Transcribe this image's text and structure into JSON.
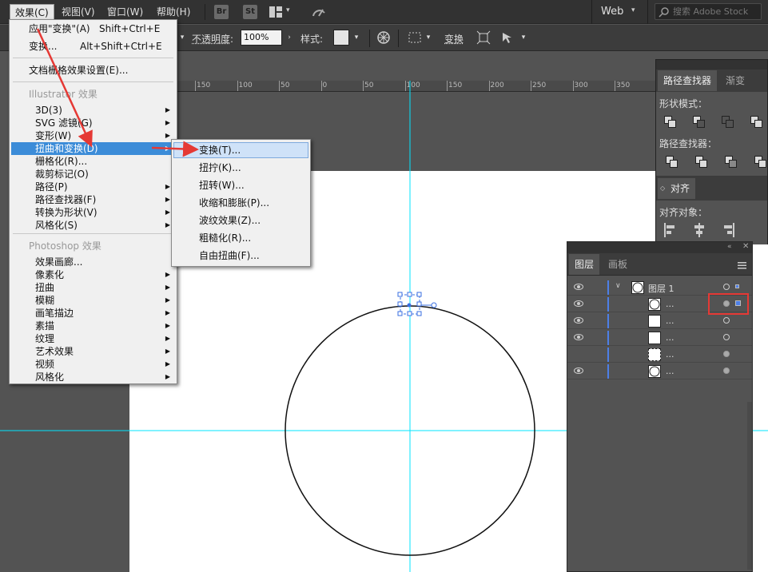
{
  "menubar": {
    "items": [
      "效果(C)",
      "视图(V)",
      "窗口(W)",
      "帮助(H)"
    ],
    "bridge_label": "Br",
    "stock_label": "St",
    "workspace": "Web",
    "search_placeholder": "搜索 Adobe Stock"
  },
  "control_bar": {
    "opacity_label": "不透明度",
    "opacity_colon": ":",
    "opacity_value": "100%",
    "style_label": "样式",
    "style_colon": ":",
    "transform_label": "变换"
  },
  "ruler": {
    "labels": [
      "150",
      "100",
      "50",
      "0",
      "50",
      "100",
      "150",
      "200",
      "250",
      "300",
      "350"
    ]
  },
  "effect_menu": {
    "apply_last_label": "应用\"变换\"(A)",
    "apply_last_shortcut": "Shift+Ctrl+E",
    "last_effect_label": "变换...",
    "last_effect_shortcut": "Alt+Shift+Ctrl+E",
    "doc_raster_settings": "文档栅格效果设置(E)...",
    "illustrator_header": "Illustrator 效果",
    "illustrator_items": [
      "3D(3)",
      "SVG 滤镜(G)",
      "变形(W)",
      "扭曲和变换(D)",
      "栅格化(R)...",
      "裁剪标记(O)",
      "路径(P)",
      "路径查找器(F)",
      "转换为形状(V)",
      "风格化(S)"
    ],
    "photoshop_header": "Photoshop 效果",
    "photoshop_items": [
      "效果画廊...",
      "像素化",
      "扭曲",
      "模糊",
      "画笔描边",
      "素描",
      "纹理",
      "艺术效果",
      "视频",
      "风格化"
    ]
  },
  "distort_submenu": {
    "items": [
      "变换(T)...",
      "扭拧(K)...",
      "扭转(W)...",
      "收缩和膨胀(P)...",
      "波纹效果(Z)...",
      "粗糙化(R)...",
      "自由扭曲(F)..."
    ]
  },
  "pathfinder_panel": {
    "tabs": [
      "路径查找器",
      "渐变"
    ],
    "shape_modes_label": "形状模式：",
    "pathfinders_label": "路径查找器：",
    "align_tab": "对齐",
    "align_objects_label": "对齐对象："
  },
  "layers_panel": {
    "tabs": [
      "图层",
      "画板"
    ],
    "layer_name": "图层 1",
    "sublayer_label": "..."
  },
  "colors": {
    "highlight": "#3c8cd8",
    "guide": "#00e5ff",
    "layer_color": "#4d7fe8",
    "annotation_red": "#e53935"
  }
}
